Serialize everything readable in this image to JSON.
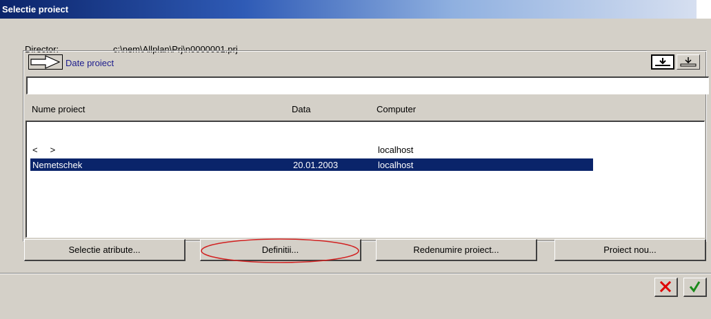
{
  "window": {
    "title": "Selectie proiect"
  },
  "director": {
    "label": "Director:",
    "value": "c:\\nem\\Allplan\\Prj\\n0000001.prj"
  },
  "project_panel": {
    "link_label": "Date proiect",
    "filter_value": "",
    "columns": [
      "Nume proiect",
      "Data",
      "Computer"
    ],
    "rows": [
      {
        "name": "<     >",
        "date": "",
        "computer": "localhost",
        "selected": false
      },
      {
        "name": "Nemetschek",
        "date": "20.01.2003",
        "computer": "localhost",
        "selected": true
      }
    ]
  },
  "buttons": {
    "select_attributes": "Selectie atribute...",
    "definitions": "Definitii...",
    "rename_project": "Redenumire proiect...",
    "new_project": "Proiect nou..."
  },
  "icons": {
    "arrow": "arrow-right-outline-icon",
    "download_a": "download-icon",
    "download_b": "download-icon",
    "cancel": "cancel-x-icon",
    "ok": "checkmark-icon"
  },
  "colors": {
    "title_bar": "#0b246a",
    "selection": "#0a246a",
    "dialog_bg": "#d4d0c8",
    "link": "#1c1c8c",
    "cancel": "#e00000",
    "ok": "#1a8a1a",
    "annotation_ellipse": "#d22020"
  }
}
